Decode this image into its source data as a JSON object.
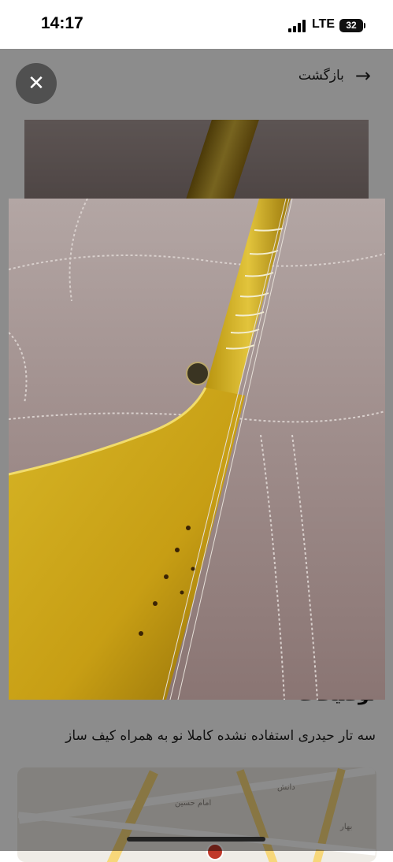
{
  "status_bar": {
    "time": "14:17",
    "network": "LTE",
    "battery": "32"
  },
  "header": {
    "back_label": "بازگشت",
    "back_icon": "arrow-right-icon"
  },
  "lightbox": {
    "close_icon": "close-icon",
    "close_glyph": "✕",
    "photo_subject": "tar-instrument-photo"
  },
  "listing": {
    "section_title": "توضیحات",
    "description": "سه تار حیدری استفاده نشده کاملا نو به همراه کیف ساز"
  },
  "map": {
    "label_1": "امام حسین",
    "label_2": "دانش",
    "label_3": "بهار"
  },
  "colors": {
    "overlay": "#000000",
    "wood": "#d4b12b",
    "sofa": "#a0908e"
  }
}
